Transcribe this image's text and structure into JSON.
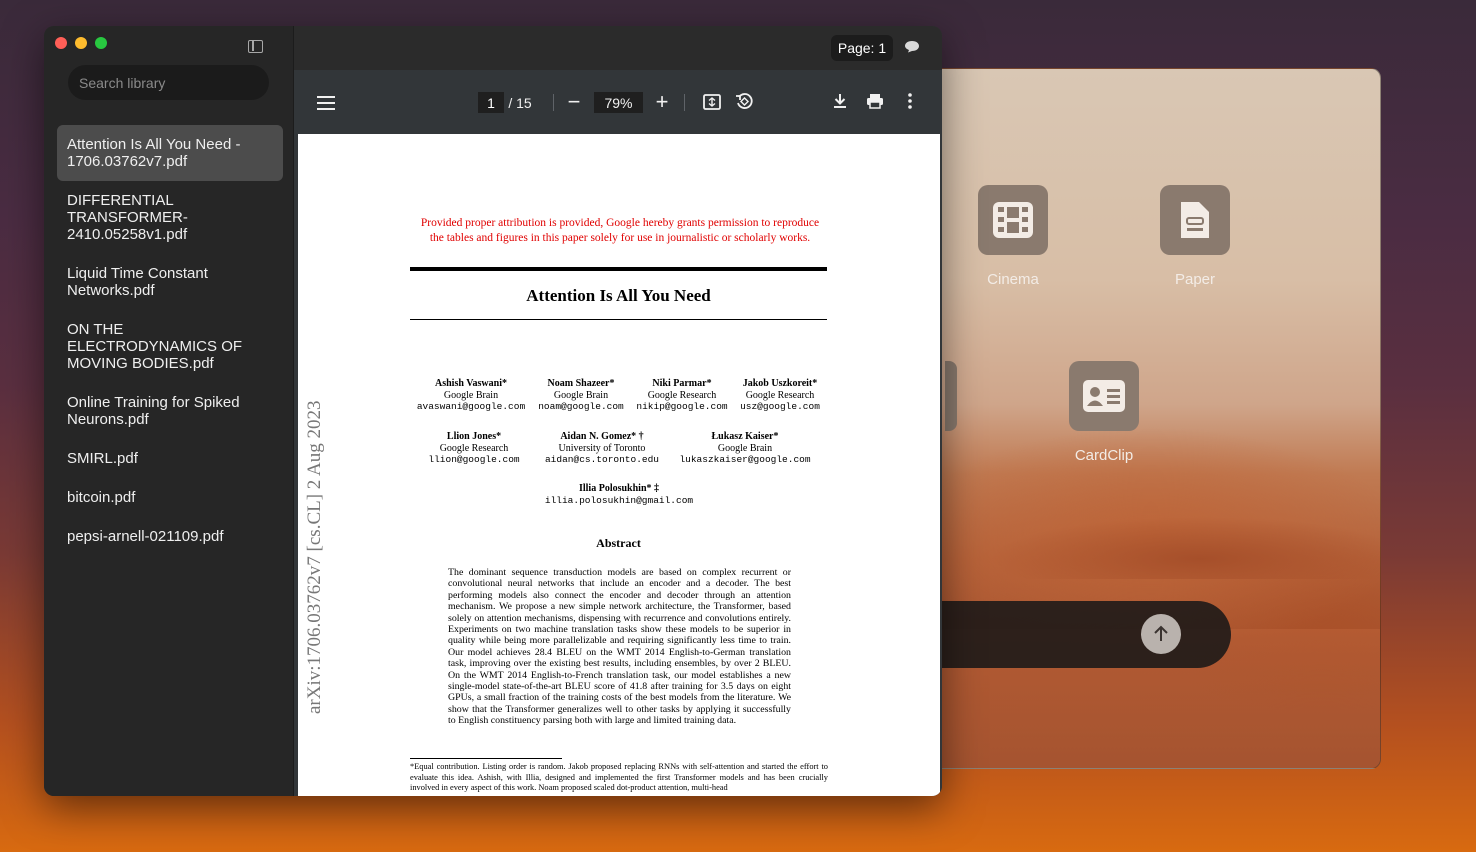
{
  "background_app": {
    "apps": [
      {
        "label": "Cinema",
        "icon": "film-icon"
      },
      {
        "label": "Paper",
        "icon": "document-icon"
      },
      {
        "label": "CardClip",
        "icon": "contact-card-icon"
      }
    ]
  },
  "sidebar": {
    "search_placeholder": "Search library",
    "files": [
      "Attention Is All You Need - 1706.03762v7.pdf",
      "DIFFERENTIAL TRANSFORMER-2410.05258v1.pdf",
      "Liquid Time Constant Networks.pdf",
      "ON THE ELECTRODYNAMICS OF MOVING BODIES.pdf",
      "Online Training for Spiked Neurons.pdf",
      "SMIRL.pdf",
      "bitcoin.pdf",
      "pepsi-arnell-021109.pdf"
    ],
    "active_index": 0
  },
  "topbar": {
    "page_label": "Page: 1"
  },
  "viewer": {
    "current_page": "1",
    "total_pages": "/ 15",
    "zoom": "79%",
    "zoom_minus": "−",
    "zoom_plus": "+"
  },
  "document": {
    "notice": "Provided proper attribution is provided, Google hereby grants permission to reproduce the tables and figures in this paper solely for use in journalistic or scholarly works.",
    "title": "Attention Is All You Need",
    "arxiv_stamp": "arXiv:1706.03762v7  [cs.CL]  2 Aug 2023",
    "authors": [
      {
        "name": "Ashish Vaswani*",
        "affil": "Google Brain",
        "email": "avaswani@google.com"
      },
      {
        "name": "Noam Shazeer*",
        "affil": "Google Brain",
        "email": "noam@google.com"
      },
      {
        "name": "Niki Parmar*",
        "affil": "Google Research",
        "email": "nikip@google.com"
      },
      {
        "name": "Jakob Uszkoreit*",
        "affil": "Google Research",
        "email": "usz@google.com"
      },
      {
        "name": "Llion Jones*",
        "affil": "Google Research",
        "email": "llion@google.com"
      },
      {
        "name": "Aidan N. Gomez* †",
        "affil": "University of Toronto",
        "email": "aidan@cs.toronto.edu"
      },
      {
        "name": "Łukasz Kaiser*",
        "affil": "Google Brain",
        "email": "lukaszkaiser@google.com"
      },
      {
        "name": "Illia Polosukhin* ‡",
        "affil": "",
        "email": "illia.polosukhin@gmail.com"
      }
    ],
    "abstract_heading": "Abstract",
    "abstract": "The dominant sequence transduction models are based on complex recurrent or convolutional neural networks that include an encoder and a decoder. The best performing models also connect the encoder and decoder through an attention mechanism. We propose a new simple network architecture, the Transformer, based solely on attention mechanisms, dispensing with recurrence and convolutions entirely. Experiments on two machine translation tasks show these models to be superior in quality while being more parallelizable and requiring significantly less time to train. Our model achieves 28.4 BLEU on the WMT 2014 English-to-German translation task, improving over the existing best results, including ensembles, by over 2 BLEU. On the WMT 2014 English-to-French translation task, our model establishes a new single-model state-of-the-art BLEU score of 41.8 after training for 3.5 days on eight GPUs, a small fraction of the training costs of the best models from the literature. We show that the Transformer generalizes well to other tasks by applying it successfully to English constituency parsing both with large and limited training data.",
    "footnote": "*Equal contribution. Listing order is random. Jakob proposed replacing RNNs with self-attention and started the effort to evaluate this idea. Ashish, with Illia, designed and implemented the first Transformer models and has been crucially involved in every aspect of this work. Noam proposed scaled dot-product attention, multi-head"
  }
}
